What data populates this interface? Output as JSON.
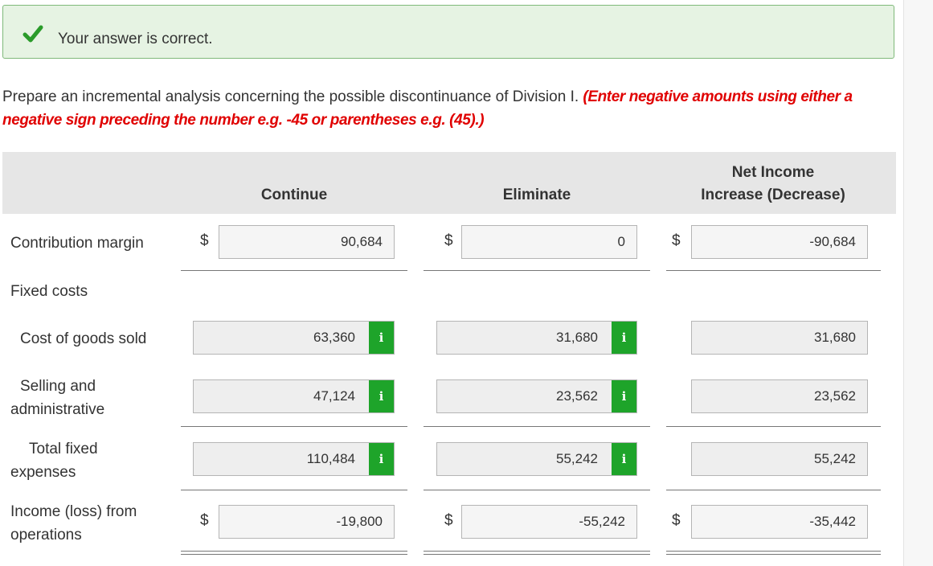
{
  "banner": {
    "message": "Your answer is correct.",
    "icon": "check-icon",
    "accent": "#2a9b2a"
  },
  "instructions": {
    "text": "Prepare an incremental analysis concerning the possible discontinuance of Division I.",
    "hint": "(Enter negative amounts using either a negative sign preceding the number e.g. -45 or parentheses e.g. (45).)"
  },
  "columns": {
    "continue": "Continue",
    "eliminate": "Eliminate",
    "net_line1": "Net Income",
    "net_line2": "Increase (Decrease)"
  },
  "currency": "$",
  "rows": {
    "contribution_margin": {
      "label": "Contribution margin",
      "continue": "90,684",
      "eliminate": "0",
      "net": "-90,684"
    },
    "fixed_costs": {
      "label": "Fixed costs"
    },
    "cogs": {
      "label": "Cost of goods sold",
      "continue": "63,360",
      "eliminate": "31,680",
      "net": "31,680"
    },
    "selling": {
      "label_line1": "Selling and",
      "label_line2": "administrative",
      "continue": "47,124",
      "eliminate": "23,562",
      "net": "23,562"
    },
    "total_fixed": {
      "label_line1": "Total fixed",
      "label_line2": "expenses",
      "continue": "110,484",
      "eliminate": "55,242",
      "net": "55,242"
    },
    "income": {
      "label_line1": "Income (loss) from",
      "label_line2": "operations",
      "continue": "-19,800",
      "eliminate": "-55,242",
      "net": "-35,442"
    }
  },
  "info_button": "i",
  "colors": {
    "hint_red": "#e00000",
    "info_green": "#1ea42a",
    "header_gray": "#e6e6e6"
  }
}
